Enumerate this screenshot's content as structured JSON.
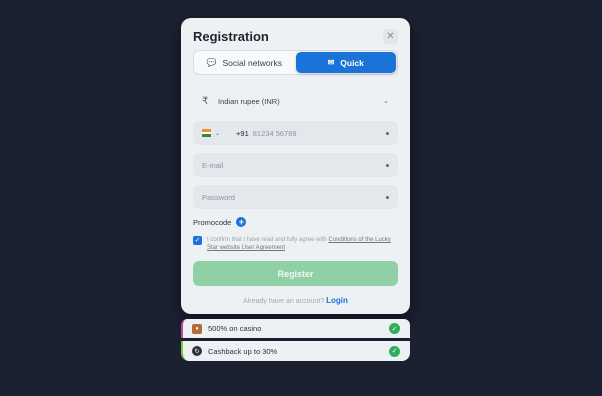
{
  "modal": {
    "title": "Registration",
    "close_icon": "close-icon"
  },
  "tabs": [
    {
      "label": "Social networks",
      "icon": "chat-bubble-icon",
      "active": false
    },
    {
      "label": "Quick",
      "icon": "envelope-icon",
      "active": true
    }
  ],
  "form": {
    "currency": {
      "symbol": "₹",
      "value": "Indian rupee (INR)"
    },
    "phone": {
      "country_code": "+91",
      "placeholder": "81234 56789"
    },
    "email": {
      "placeholder": "E-mail"
    },
    "password": {
      "placeholder": "Password"
    },
    "promocode_label": "Promocode",
    "agreement_text": "I confirm that I have read and fully agree with",
    "agreement_link": "Conditions of the Lucky Star website User Agreement",
    "register_label": "Register",
    "login_prompt": "Already have an account?",
    "login_link": "Login"
  },
  "bonuses": [
    {
      "label": "500% on casino",
      "icon": "casino-icon"
    },
    {
      "label": "Cashback up to 30%",
      "icon": "cashback-icon"
    }
  ],
  "colors": {
    "background": "#1b2130",
    "accent": "#1a73d9",
    "register_disabled": "#8fd0a6",
    "check_green": "#2fae5e"
  }
}
